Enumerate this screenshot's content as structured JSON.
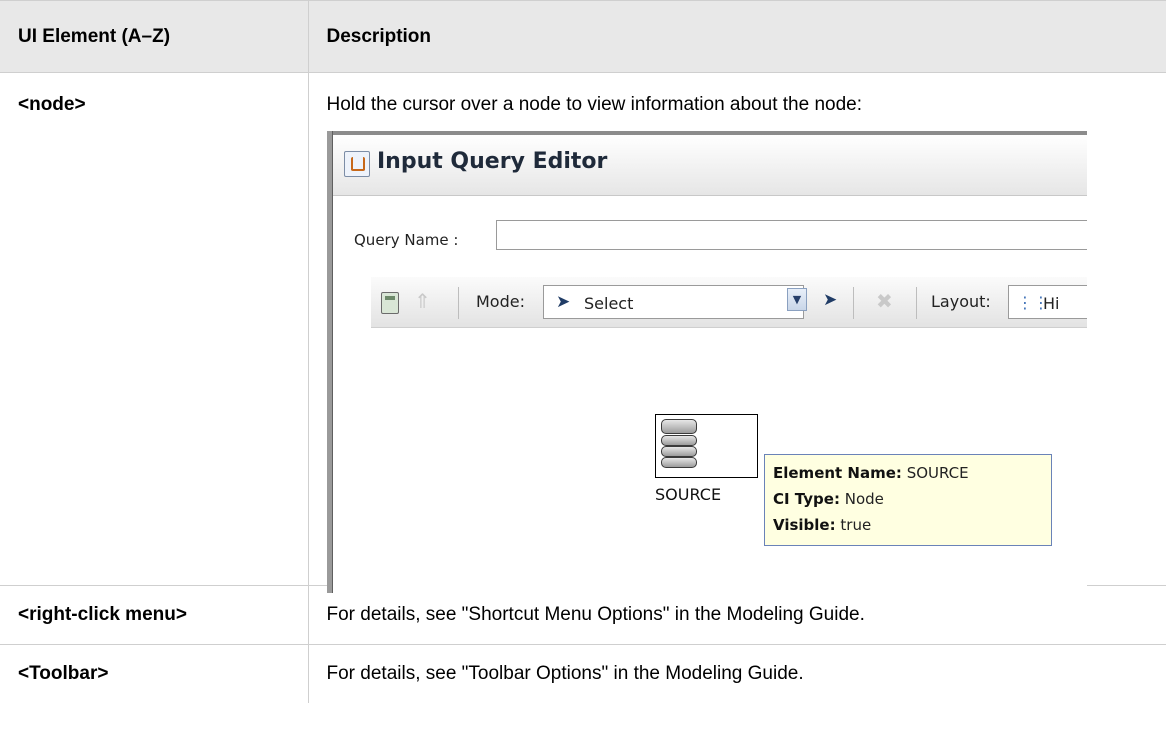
{
  "table": {
    "headers": [
      "UI Element (A–Z)",
      "Description"
    ],
    "rows": [
      {
        "element": "<node>",
        "description": "Hold the cursor over a node to view information about the node:"
      },
      {
        "element": "<right-click menu>",
        "description": "For details, see \"Shortcut Menu Options\" in the Modeling Guide."
      },
      {
        "element": "<Toolbar>",
        "description": "For details, see \"Toolbar Options\" in the Modeling Guide."
      }
    ]
  },
  "screenshot": {
    "window_title": "Input Query Editor",
    "query_name_label": "Query Name :",
    "query_name_value": "",
    "toolbar": {
      "mode_label": "Mode:",
      "mode_value": "Select",
      "layout_label": "Layout:",
      "layout_value": "Hi"
    },
    "node": {
      "label": "SOURCE"
    },
    "tooltip": {
      "lines": [
        {
          "key": "Element Name",
          "value": "SOURCE"
        },
        {
          "key": "CI Type",
          "value": "Node"
        },
        {
          "key": "Visible",
          "value": "true"
        }
      ]
    }
  }
}
